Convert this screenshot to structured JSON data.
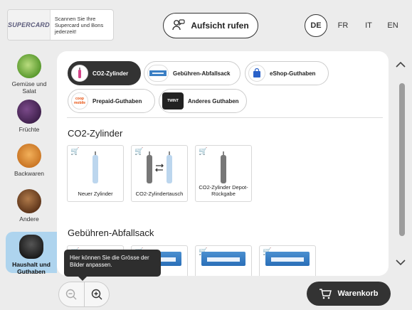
{
  "header": {
    "supercard_logo": "SUPERCARD",
    "supercard_text": "Scannen Sie Ihre Supercard und Bons jederzeit!",
    "aufsicht_label": "Aufsicht rufen",
    "languages": [
      "DE",
      "FR",
      "IT",
      "EN"
    ],
    "active_language": "DE"
  },
  "categories": [
    {
      "label": "Gemüse und Salat",
      "icon": "lettuce-icon"
    },
    {
      "label": "Früchte",
      "icon": "grapes-icon"
    },
    {
      "label": "Backwaren",
      "icon": "croissant-icon"
    },
    {
      "label": "Andere",
      "icon": "chocolate-icon"
    },
    {
      "label": "Haushalt und Guthaben",
      "icon": "trash-bag-icon",
      "active": true
    }
  ],
  "chips": [
    {
      "label": "CO2-Zylinder",
      "active": true,
      "icon": "co2-cylinder-icon"
    },
    {
      "label": "Gebühren-Abfallsack",
      "active": false,
      "icon": "garbage-bag-icon"
    },
    {
      "label": "eShop-Guthaben",
      "active": false,
      "icon": "shopping-bag-icon"
    },
    {
      "label": "Prepaid-Guthaben",
      "active": false,
      "icon": "coop-mobile-icon",
      "icon_text": "coop mobile"
    },
    {
      "label": "Anderes Guthaben",
      "active": false,
      "icon": "twint-icon",
      "icon_text": "TWINT"
    }
  ],
  "sections": [
    {
      "title": "CO2-Zylinder",
      "products": [
        {
          "label": "Neuer Zylinder"
        },
        {
          "label": "CO2-Zylindertausch"
        },
        {
          "label": "CO2-Zylinder Depot-Rückgabe"
        }
      ]
    },
    {
      "title": "Gebühren-Abfallsack",
      "products": [
        {
          "label": ""
        },
        {
          "label": ""
        },
        {
          "label": ""
        },
        {
          "label": ""
        }
      ]
    }
  ],
  "tooltip": "Hier können Sie die Grösse der Bilder anpassen.",
  "cart_label": "Warenkorb",
  "colors": {
    "accent_dark": "#333333",
    "active_category": "#aed4ee",
    "cart_icon": "#e8a21a"
  }
}
